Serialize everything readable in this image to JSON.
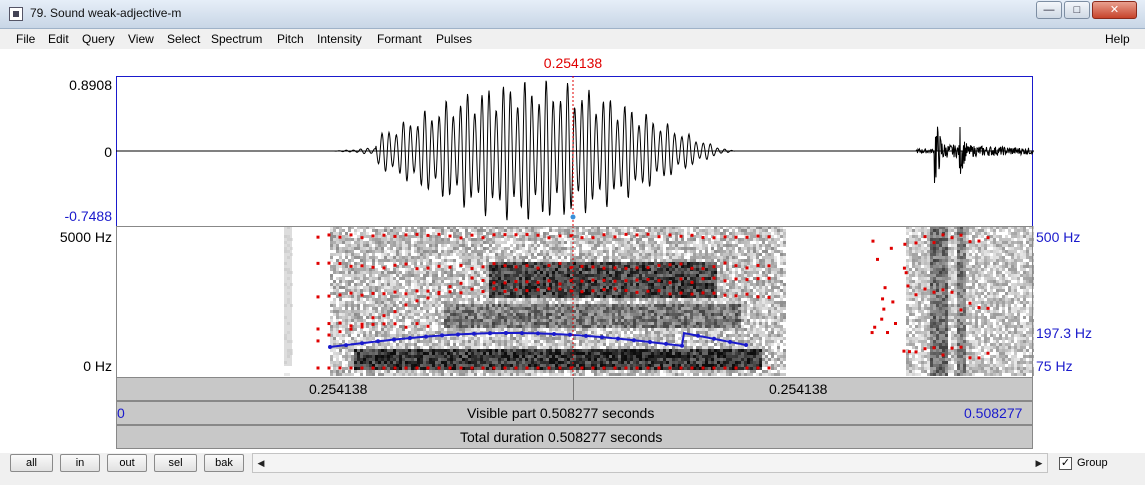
{
  "window": {
    "title": "79. Sound weak-adjective-m",
    "min_glyph": "—",
    "max_glyph": "□",
    "close_glyph": "✕"
  },
  "menu": [
    "File",
    "Edit",
    "Query",
    "View",
    "Select",
    "Spectrum",
    "Pitch",
    "Intensity",
    "Formant",
    "Pulses"
  ],
  "help_label": "Help",
  "cursor": {
    "time": "0.254138"
  },
  "waveform": {
    "max_label": "0.8908",
    "zero_label": "0",
    "min_label": "-0.7488"
  },
  "spectrogram": {
    "top_label": "5000 Hz",
    "bottom_label": "0 Hz",
    "pitch_top": "500 Hz",
    "pitch_value": "197.3 Hz",
    "pitch_bottom": "75 Hz"
  },
  "bands": {
    "left_time": "0.254138",
    "right_time": "0.254138",
    "start": "0",
    "visible": "Visible part 0.508277 seconds",
    "end": "0.508277",
    "total": "Total duration 0.508277 seconds"
  },
  "buttons": {
    "all": "all",
    "in": "in",
    "out": "out",
    "sel": "sel",
    "bak": "bak"
  },
  "scroll": {
    "left": "◀",
    "right": "▶"
  },
  "group": {
    "checked": "✓",
    "label": "Group"
  },
  "colors": {
    "cursor": "#e00000",
    "pitch": "#1a1acc",
    "formant": "#e00000"
  }
}
